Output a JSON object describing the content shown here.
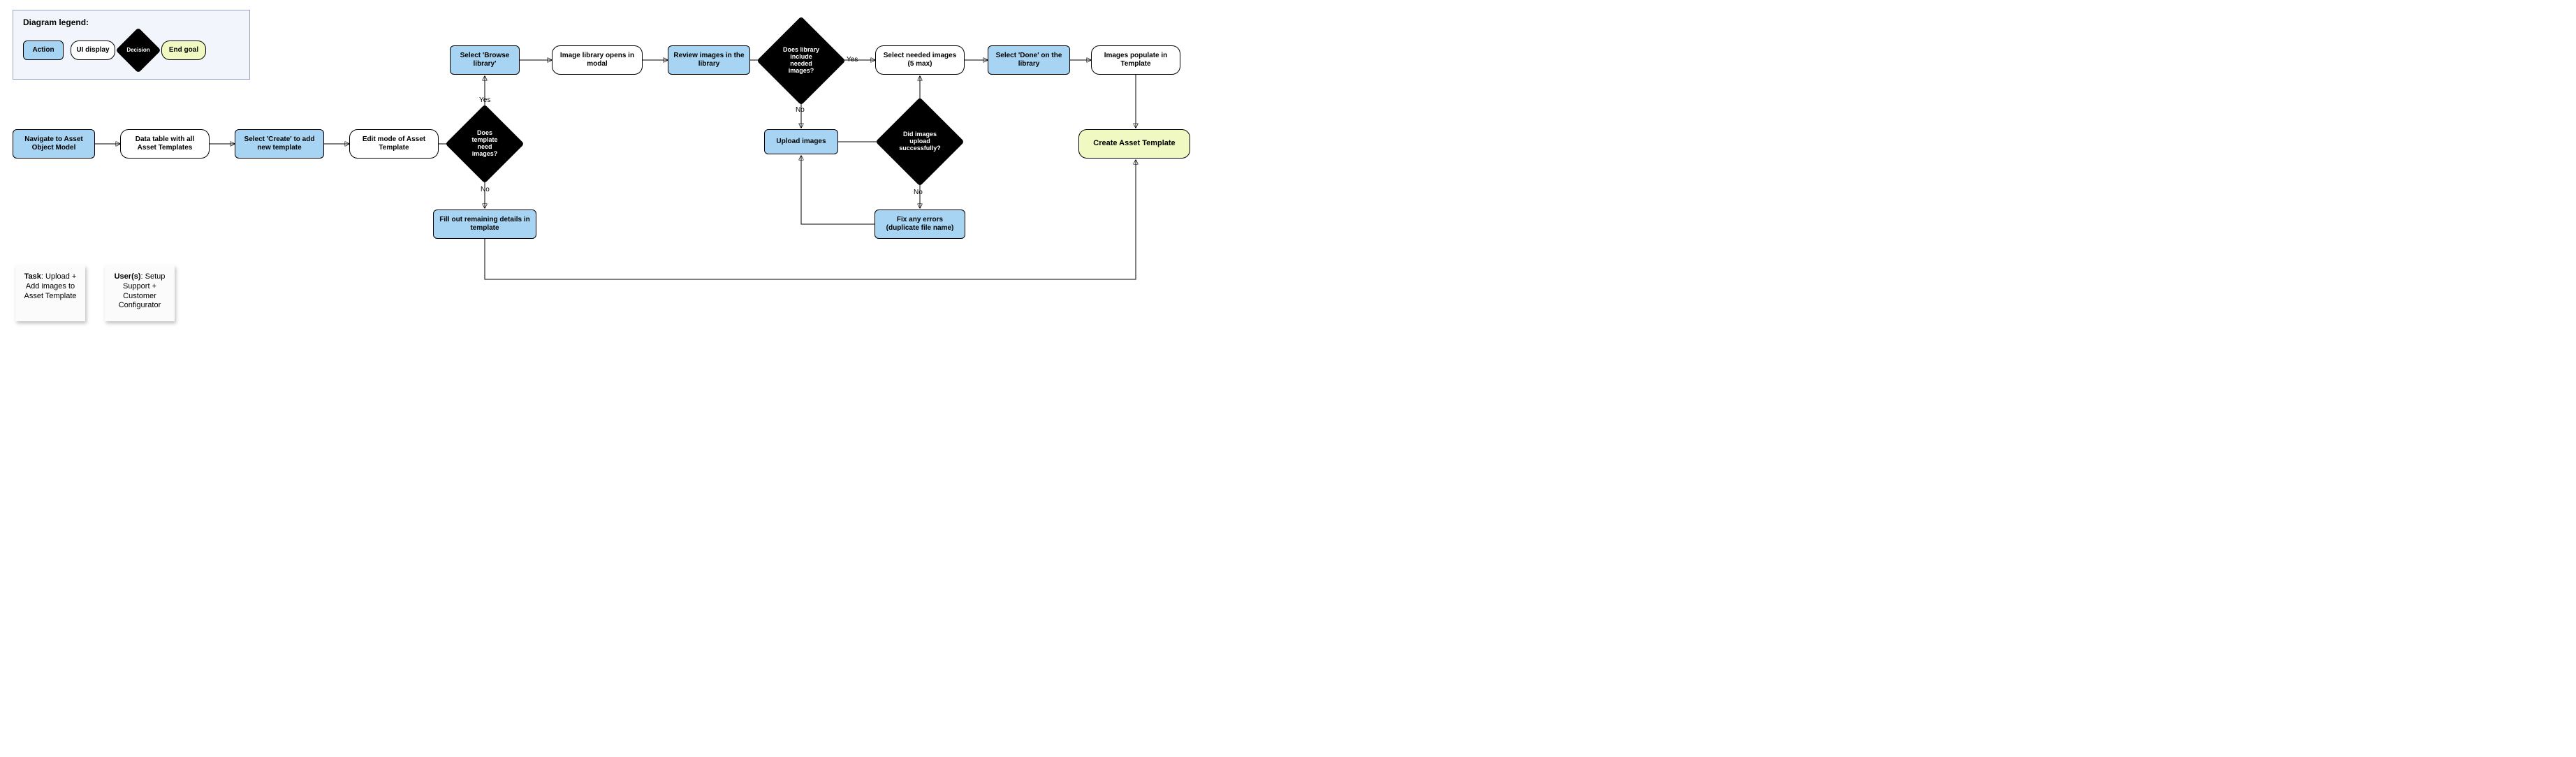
{
  "legend": {
    "title": "Diagram legend:",
    "action": "Action",
    "display": "UI display",
    "decision": "Decision",
    "goal": "End goal"
  },
  "sticky_task_label": "Task",
  "sticky_task_text": ": Upload + Add images to Asset Template",
  "sticky_user_label": "User(s)",
  "sticky_user_text": ": Setup Support + Customer Configurator",
  "nodes": {
    "navigate": "Navigate to Asset Object Model",
    "datatable": "Data table with all Asset Templates",
    "create": "Select 'Create' to add new template",
    "editmode": "Edit mode of Asset Template",
    "need_images": "Does template need images?",
    "browse": "Select 'Browse library'",
    "library_modal": "Image library opens in modal",
    "review": "Review images in the library",
    "lib_include": "Does library include needed images?",
    "select_needed": "Select needed images (5 max)",
    "done": "Select 'Done' on the library",
    "populate": "Images populate in Template",
    "upload": "Upload images",
    "upload_ok": "Did images upload successfully?",
    "fix_errors": "Fix any errors (duplicate file name)",
    "fill_out": "Fill out remaining details in template",
    "create_template": "Create Asset Template"
  },
  "labels": {
    "yes1": "Yes",
    "no1": "No",
    "yes2": "Yes",
    "no2": "No",
    "no3": "No"
  }
}
